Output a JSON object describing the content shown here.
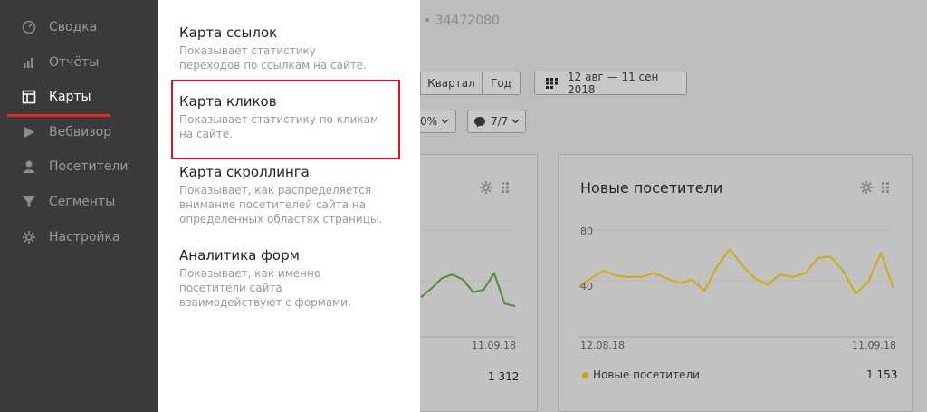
{
  "sidebar": {
    "items": [
      {
        "label": "Сводка",
        "icon": "dashboard-icon"
      },
      {
        "label": "Отчёты",
        "icon": "bar-chart-icon"
      },
      {
        "label": "Карты",
        "icon": "map-layout-icon"
      },
      {
        "label": "Вебвизор",
        "icon": "play-icon"
      },
      {
        "label": "Посетители",
        "icon": "user-icon"
      },
      {
        "label": "Сегменты",
        "icon": "filter-icon"
      },
      {
        "label": "Настройка",
        "icon": "gear-icon"
      }
    ],
    "active_index": 2,
    "accent_color": "#e8261b"
  },
  "header": {
    "counter_id": "• 34472080"
  },
  "period": {
    "buttons": [
      "Квартал",
      "Год"
    ],
    "date_range": "12 авг — 11 сен 2018"
  },
  "filters": {
    "sample": "0%",
    "segments": "7/7"
  },
  "widgets": {
    "left": {
      "x_end_label": "11.09.18",
      "total": "1 312",
      "line_color": "#4e8f2f"
    },
    "right": {
      "title": "Новые посетители",
      "y_labels": [
        "80",
        "40"
      ],
      "x_start_label": "12.08.18",
      "x_end_label": "11.09.18",
      "legend": "Новые посетители",
      "total": "1 153",
      "line_color": "#d4a90c"
    }
  },
  "maps_menu": {
    "items": [
      {
        "title": "Карта ссылок",
        "desc": "Показывает статистику переходов по ссылкам на сайте."
      },
      {
        "title": "Карта кликов",
        "desc": "Показывает статистику по кликам на сайте."
      },
      {
        "title": "Карта скроллинга",
        "desc": "Показывает, как распределяется внимание посетителей сайта на определенных областях страницы."
      },
      {
        "title": "Аналитика форм",
        "desc": "Показывает, как именно посетители сайта взаимодействуют с формами."
      }
    ],
    "highlight_color": "#e0141e"
  },
  "chart_data": [
    {
      "type": "line",
      "series": [
        {
          "values": [
            27,
            34,
            42,
            45,
            41,
            31,
            33,
            46,
            22,
            20
          ]
        }
      ]
    },
    {
      "type": "line",
      "x": [
        "12.08.18",
        "",
        "",
        "",
        "",
        "",
        "",
        "",
        "",
        "",
        "",
        "",
        "",
        "",
        "",
        "",
        "",
        "",
        "",
        "",
        "",
        "",
        "",
        "",
        "",
        "",
        "",
        "",
        "",
        "11.09.18"
      ],
      "y_ticks": [
        40,
        80
      ],
      "series": [
        {
          "name": "Новые посетители",
          "values": [
            35,
            42,
            48,
            44,
            43,
            43,
            46,
            42,
            38,
            41,
            32,
            51,
            65,
            52,
            42,
            37,
            45,
            43,
            46,
            58,
            59,
            48,
            30,
            39,
            62,
            34
          ]
        }
      ]
    }
  ]
}
